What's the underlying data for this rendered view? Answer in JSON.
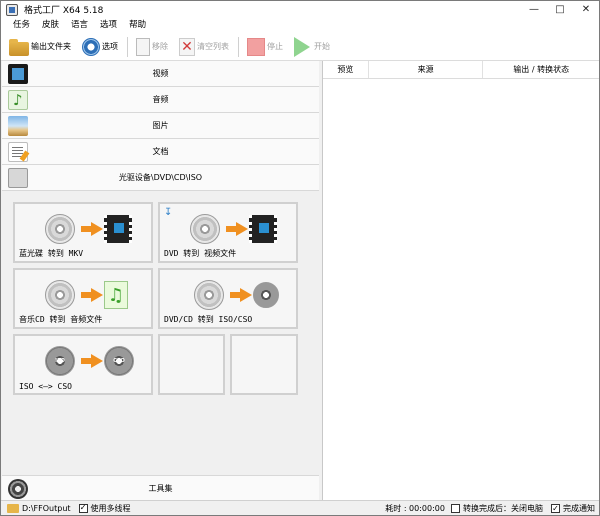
{
  "window": {
    "title": "格式工厂 X64 5.18"
  },
  "menu": [
    "任务",
    "皮肤",
    "语言",
    "选项",
    "帮助"
  ],
  "toolbar": {
    "output_folder": "输出文件夹",
    "options": "选项",
    "remove": "移除",
    "clear_list": "清空列表",
    "stop": "停止",
    "start": "开始"
  },
  "categories": {
    "video": "视频",
    "audio": "音频",
    "image": "图片",
    "document": "文档",
    "disc": "光驱设备\\DVD\\CD\\ISO"
  },
  "disc_tools": {
    "bluray_mkv": "蓝光碟 转到 MKV",
    "dvd_video": "DVD 转到 视频文件",
    "cd_audio": "音乐CD 转到 音频文件",
    "dvd_iso": "DVD/CD 转到 ISO/CSO",
    "iso_cso": "ISO <—> CSO",
    "iso_tag": "ISO",
    "cso_tag": "CSO"
  },
  "toolbox": "工具集",
  "task_columns": {
    "preview": "预览",
    "source": "来源",
    "output_status": "输出 / 转换状态"
  },
  "status": {
    "output_path": "D:\\FFOutput",
    "multithread": "使用多线程",
    "elapsed": "耗时 : 00:00:00",
    "after_convert": "转换完成后：关闭电脑",
    "notify": "完成通知"
  }
}
